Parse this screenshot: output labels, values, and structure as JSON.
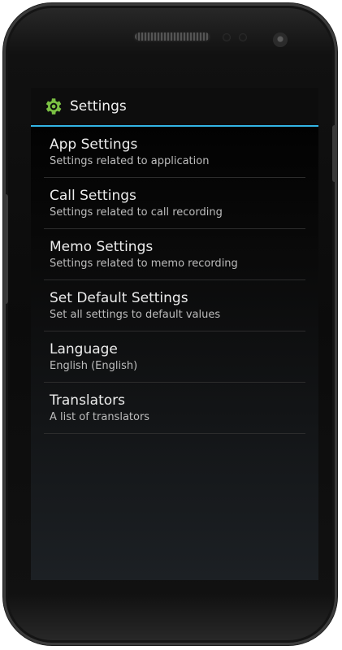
{
  "action_bar": {
    "icon": "gear-icon",
    "title": "Settings",
    "accent_color": "#33b5e5",
    "icon_color": "#7bc043"
  },
  "settings_list": [
    {
      "title": "App Settings",
      "subtitle": "Settings related to application"
    },
    {
      "title": "Call Settings",
      "subtitle": "Settings related to call recording"
    },
    {
      "title": "Memo Settings",
      "subtitle": "Settings related to memo recording"
    },
    {
      "title": "Set Default Settings",
      "subtitle": "Set all settings to default values"
    },
    {
      "title": "Language",
      "subtitle": "English (English)"
    },
    {
      "title": "Translators",
      "subtitle": "A list of translators"
    }
  ]
}
